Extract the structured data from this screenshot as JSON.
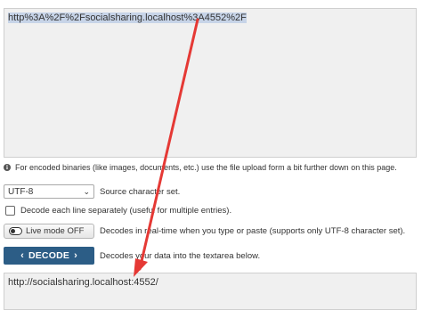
{
  "input": {
    "value": "http%3A%2F%2Fsocialsharing.localhost%3A4552%2F"
  },
  "info": {
    "text": "For encoded binaries (like images, documents, etc.) use the file upload form a bit further down on this page."
  },
  "charset": {
    "selected": "UTF-8",
    "label": "Source character set."
  },
  "each_line": {
    "label": "Decode each line separately (useful for multiple entries)."
  },
  "live_mode": {
    "button_label": "Live mode OFF",
    "description": "Decodes in real-time when you type or paste (supports only UTF-8 character set)."
  },
  "decode": {
    "button_label": "DECODE",
    "description": "Decodes your data into the textarea below."
  },
  "output": {
    "value": "http://socialsharing.localhost:4552/"
  },
  "annotation": {
    "arrow_color": "#e53935"
  },
  "colors": {
    "decode_button": "#2c5d86",
    "textarea_bg": "#f0f0f0",
    "selection": "#c7d4e8"
  }
}
